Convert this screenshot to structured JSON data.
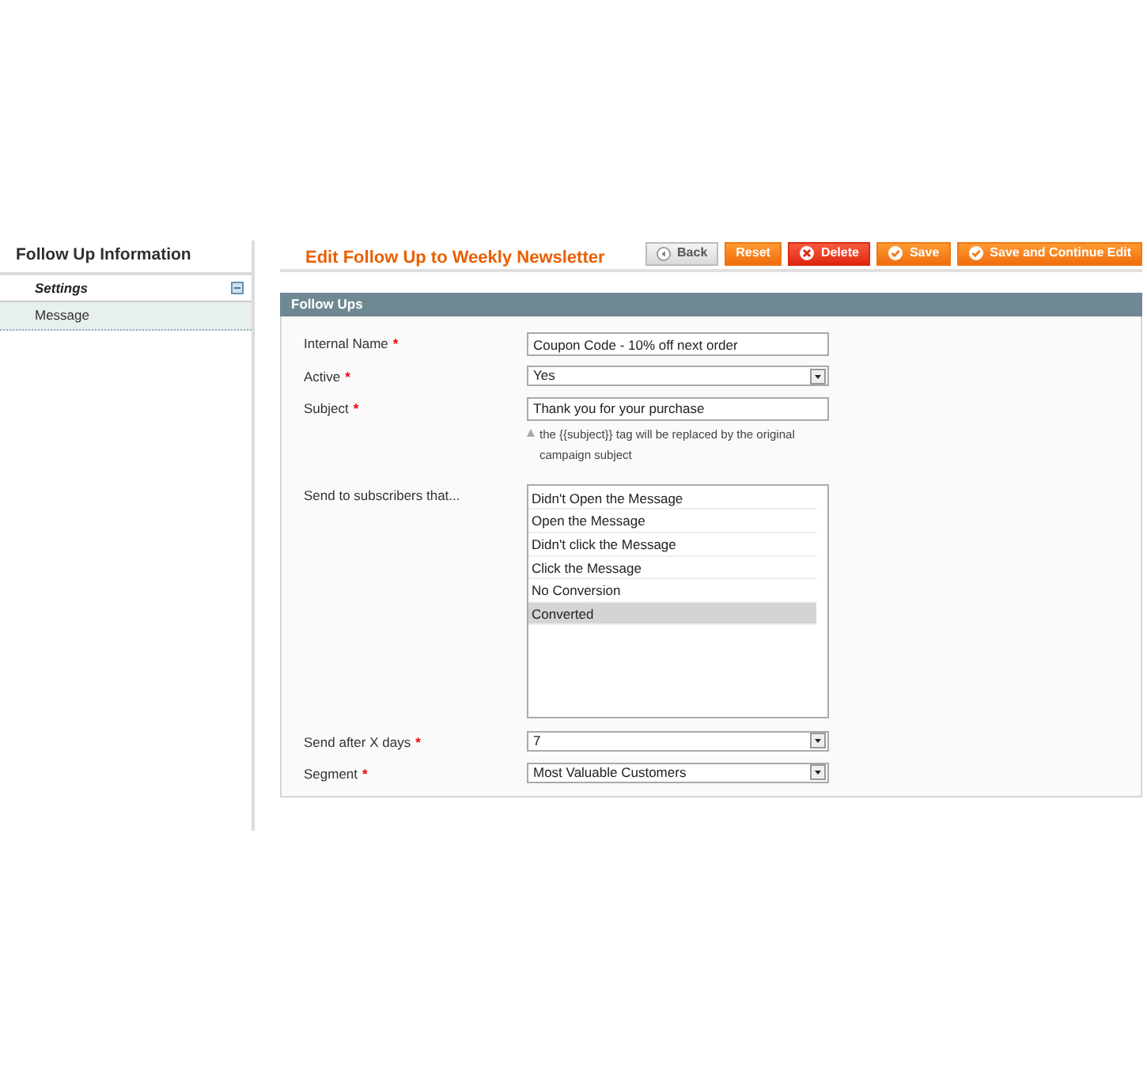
{
  "sidebar": {
    "title": "Follow Up Information",
    "group": "Settings",
    "tabs": [
      {
        "label": "Message",
        "selected": true
      }
    ]
  },
  "header": {
    "title": "Edit Follow Up to Weekly Newsletter"
  },
  "buttons": [
    {
      "label": "Back",
      "kind": "back"
    },
    {
      "label": "Reset",
      "kind": "plain"
    },
    {
      "label": "Delete",
      "kind": "delete"
    },
    {
      "label": "Save",
      "kind": "save"
    },
    {
      "label": "Save and Continue Edit",
      "kind": "save"
    }
  ],
  "section": {
    "title": "Follow Ups"
  },
  "fields": [
    {
      "label": "Internal Name",
      "required_mark": "*",
      "kind": "text",
      "value": "Coupon Code - 10% off next order"
    },
    {
      "label": "Active",
      "required_mark": "*",
      "kind": "select",
      "value": "Yes"
    },
    {
      "label": "Subject",
      "required_mark": "*",
      "kind": "text",
      "value": "Thank you for your purchase",
      "note": "the {{subject}} tag will be replaced by the original campaign subject"
    },
    {
      "label": "Send to subscribers that...",
      "kind": "multiselect",
      "options": [
        {
          "label": "Didn't Open the Message",
          "selected": false
        },
        {
          "label": "Open the Message",
          "selected": false
        },
        {
          "label": "Didn't click the Message",
          "selected": false
        },
        {
          "label": "Click the Message",
          "selected": false
        },
        {
          "label": "No Conversion",
          "selected": false
        },
        {
          "label": "Converted",
          "selected": true
        }
      ]
    },
    {
      "label": "Send after X days",
      "required_mark": "*",
      "kind": "select",
      "value": "7"
    },
    {
      "label": "Segment",
      "required_mark": "*",
      "kind": "select",
      "value": "Most Valuable Customers"
    }
  ]
}
